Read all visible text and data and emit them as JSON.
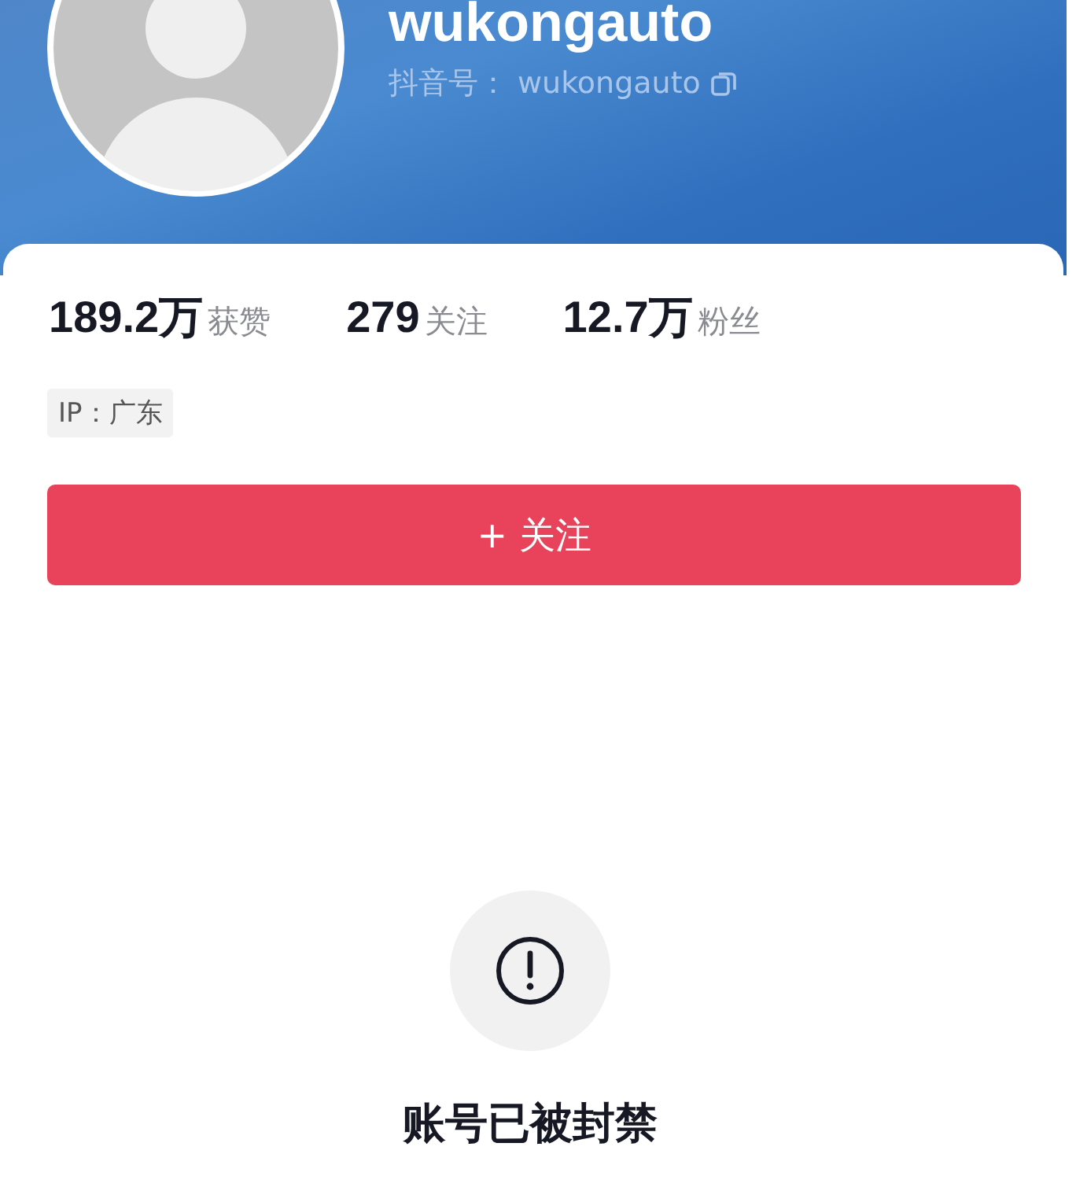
{
  "profile": {
    "name": "wukongauto",
    "id_label": "抖音号：",
    "id_value": "wukongauto"
  },
  "stats": [
    {
      "value": "189.2万",
      "label": "获赞"
    },
    {
      "value": "279",
      "label": "关注"
    },
    {
      "value": "12.7万",
      "label": "粉丝"
    }
  ],
  "ip_tag": "IP：广东",
  "follow_button": "+ 关注",
  "notice": {
    "title": "账号已被封禁"
  }
}
